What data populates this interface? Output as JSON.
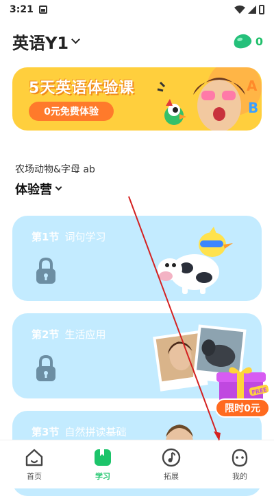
{
  "status": {
    "time": "3:21"
  },
  "header": {
    "title": "英语Y1",
    "gems": "0"
  },
  "banner": {
    "title": "5天英语体验课",
    "pill": "0元免费体验"
  },
  "camp": {
    "subtitle": "农场动物&字母 ab",
    "name": "体验营"
  },
  "lessons": [
    {
      "number": "第1节",
      "name": "词句学习"
    },
    {
      "number": "第2节",
      "name": "生活应用"
    },
    {
      "number": "第3节",
      "name": "自然拼读基础"
    }
  ],
  "promo": {
    "label": "限时0元",
    "tag": "FREE"
  },
  "tabs": [
    {
      "label": "首页",
      "icon": "home-icon"
    },
    {
      "label": "学习",
      "icon": "study-icon"
    },
    {
      "label": "拓展",
      "icon": "music-note-icon"
    },
    {
      "label": "我的",
      "icon": "face-icon"
    }
  ],
  "colors": {
    "accent": "#1cc46a",
    "banner": "#ffcf3d",
    "lesson_card": "#c3ebff",
    "promo": "#ff6a1f"
  }
}
